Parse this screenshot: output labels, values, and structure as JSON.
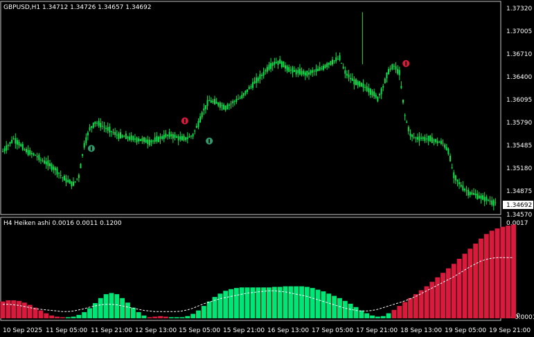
{
  "main_chart": {
    "header": "GBPUSD,H1  1.34712 1.34726 1.34657 1.34692",
    "current_price": "1.34692",
    "price_labels": [
      "1.37320",
      "1.37005",
      "1.36710",
      "1.36400",
      "1.36095",
      "1.35790",
      "1.35485",
      "1.35180",
      "1.34875",
      "1.34570"
    ],
    "candle_color": "#00e64d",
    "background": "#000000"
  },
  "indicator": {
    "header": "H4 Heiken ashi  0.0016 0.0011 0.1200",
    "scale_top": "0.0017",
    "scale_bottom": "0.00",
    "scale_bottom2": "0.0001",
    "bull_color": "#00e676",
    "bear_color": "#d91a3c",
    "signal_color": "#ffffff"
  },
  "signals": [
    {
      "type": "buy",
      "icon": "up-arrow-icon",
      "color": "#2e9e6e"
    },
    {
      "type": "sell",
      "icon": "down-arrow-icon",
      "color": "#d91a3c"
    },
    {
      "type": "buy",
      "icon": "up-arrow-icon",
      "color": "#2e9e6e"
    },
    {
      "type": "sell",
      "icon": "down-arrow-icon",
      "color": "#d91a3c"
    }
  ],
  "time_labels": [
    "10 Sep 2025",
    "11 Sep 05:00",
    "11 Sep 21:00",
    "12 Sep 13:00",
    "15 Sep 05:00",
    "15 Sep 21:00",
    "16 Sep 13:00",
    "17 Sep 05:00",
    "17 Sep 21:00",
    "18 Sep 13:00",
    "19 Sep 05:00",
    "19 Sep 21:00"
  ],
  "chart_data": {
    "type": "bar",
    "price_series": [
      1.3538,
      1.3546,
      1.3555,
      1.3549,
      1.354,
      1.3536,
      1.3533,
      1.3527,
      1.3523,
      1.3518,
      1.3512,
      1.3503,
      1.3498,
      1.3494,
      1.3505,
      1.3547,
      1.3568,
      1.3577,
      1.3574,
      1.3569,
      1.3565,
      1.356,
      1.3558,
      1.3557,
      1.3555,
      1.3554,
      1.3553,
      1.3551,
      1.3553,
      1.3556,
      1.3559,
      1.356,
      1.3557,
      1.3555,
      1.3556,
      1.356,
      1.3576,
      1.3594,
      1.3606,
      1.3604,
      1.3601,
      1.3597,
      1.3602,
      1.3607,
      1.3611,
      1.362,
      1.3628,
      1.3635,
      1.3643,
      1.3652,
      1.3657,
      1.3658,
      1.3652,
      1.3647,
      1.3645,
      1.3644,
      1.3642,
      1.3645,
      1.3647,
      1.3651,
      1.3656,
      1.366,
      1.3663,
      1.3644,
      1.3636,
      1.363,
      1.3627,
      1.3623,
      1.3617,
      1.3609,
      1.3625,
      1.3646,
      1.3653,
      1.3643,
      1.3586,
      1.356,
      1.3556,
      1.3556,
      1.3555,
      1.3554,
      1.3551,
      1.3549,
      1.3539,
      1.3505,
      1.3495,
      1.3487,
      1.3482,
      1.348,
      1.3476,
      1.3474,
      1.347,
      1.3469
    ],
    "osc_values": [
      0.0003,
      0.00032,
      0.00032,
      0.00031,
      0.00028,
      0.00024,
      0.00019,
      0.00014,
      9e-05,
      5e-05,
      3e-05,
      2e-05,
      2e-05,
      3e-05,
      6e-05,
      0.00011,
      0.00018,
      0.00027,
      0.00036,
      0.00043,
      0.00045,
      0.00043,
      0.00036,
      0.00028,
      0.00019,
      0.00011,
      5e-05,
      2e-05,
      3e-05,
      4e-05,
      3e-05,
      2e-05,
      2e-05,
      2e-05,
      4e-05,
      8e-05,
      0.00014,
      0.00022,
      0.0003,
      0.00038,
      0.00044,
      0.00049,
      0.00052,
      0.00054,
      0.00055,
      0.00055,
      0.00055,
      0.00055,
      0.00055,
      0.00055,
      0.00056,
      0.00056,
      0.00057,
      0.00057,
      0.00057,
      0.00057,
      0.00056,
      0.00054,
      0.00051,
      0.00048,
      0.00044,
      0.0004,
      0.00036,
      0.00031,
      0.00026,
      0.0002,
      0.00014,
      9e-05,
      5e-05,
      3e-05,
      4e-05,
      9e-05,
      0.00015,
      0.00022,
      0.00029,
      0.00036,
      0.00043,
      0.0005,
      0.00057,
      0.00065,
      0.00073,
      0.00081,
      0.00089,
      0.00097,
      0.00106,
      0.00115,
      0.00124,
      0.00133,
      0.00142,
      0.0015,
      0.00156,
      0.0016,
      0.00163,
      0.00165,
      0.00167
    ],
    "osc_colors": [
      "bear",
      "bear",
      "bear",
      "bear",
      "bear",
      "bear",
      "bear",
      "bear",
      "bear",
      "bear",
      "bear",
      "bear",
      "bull",
      "bull",
      "bull",
      "bull",
      "bull",
      "bull",
      "bull",
      "bull",
      "bull",
      "bull",
      "bull",
      "bull",
      "bull",
      "bull",
      "bull",
      "bear",
      "bear",
      "bear",
      "bear",
      "bull",
      "bull",
      "bull",
      "bull",
      "bull",
      "bull",
      "bull",
      "bull",
      "bull",
      "bull",
      "bull",
      "bull",
      "bull",
      "bull",
      "bull",
      "bull",
      "bull",
      "bull",
      "bull",
      "bull",
      "bull",
      "bull",
      "bull",
      "bull",
      "bull",
      "bull",
      "bull",
      "bull",
      "bull",
      "bull",
      "bull",
      "bull",
      "bull",
      "bull",
      "bull",
      "bull",
      "bull",
      "bull",
      "bull",
      "bull",
      "bull",
      "bear",
      "bear",
      "bear",
      "bear",
      "bear",
      "bear",
      "bear",
      "bear",
      "bear",
      "bear",
      "bear",
      "bear",
      "bear",
      "bear",
      "bear",
      "bear",
      "bear",
      "bear",
      "bear",
      "bear",
      "bear",
      "bear",
      "bear"
    ],
    "signal_line": [
      0.00025,
      0.00025,
      0.00024,
      0.00023,
      0.00021,
      0.00019,
      0.00017,
      0.00016,
      0.00015,
      0.00014,
      0.00013,
      0.00012,
      0.00012,
      0.00013,
      0.00015,
      0.00017,
      0.0002,
      0.00022,
      0.00024,
      0.00025,
      0.00025,
      0.00024,
      0.00022,
      0.0002,
      0.00018,
      0.00016,
      0.00014,
      0.00013,
      0.00012,
      0.00012,
      0.00012,
      0.00012,
      0.00012,
      0.00013,
      0.00015,
      0.00018,
      0.00022,
      0.00026,
      0.00029,
      0.00032,
      0.00035,
      0.00037,
      0.00039,
      0.00041,
      0.00043,
      0.00045,
      0.00046,
      0.00047,
      0.00048,
      0.00049,
      0.00049,
      0.00048,
      0.00047,
      0.00045,
      0.00043,
      0.00041,
      0.00039,
      0.00036,
      0.00033,
      0.0003,
      0.00027,
      0.00024,
      0.00021,
      0.00018,
      0.00016,
      0.00014,
      0.00013,
      0.00013,
      0.00014,
      0.00016,
      0.00019,
      0.00022,
      0.00025,
      0.00028,
      0.00031,
      0.00035,
      0.00039,
      0.00044,
      0.00049,
      0.00054,
      0.00059,
      0.00064,
      0.00069,
      0.00074,
      0.0008,
      0.00086,
      0.00092,
      0.00097,
      0.00102,
      0.00105,
      0.00107,
      0.00108,
      0.00108,
      0.00108,
      0.00108
    ],
    "ylim_price": [
      1.3457,
      1.3732
    ],
    "ylim_osc": [
      0,
      0.0017
    ]
  }
}
